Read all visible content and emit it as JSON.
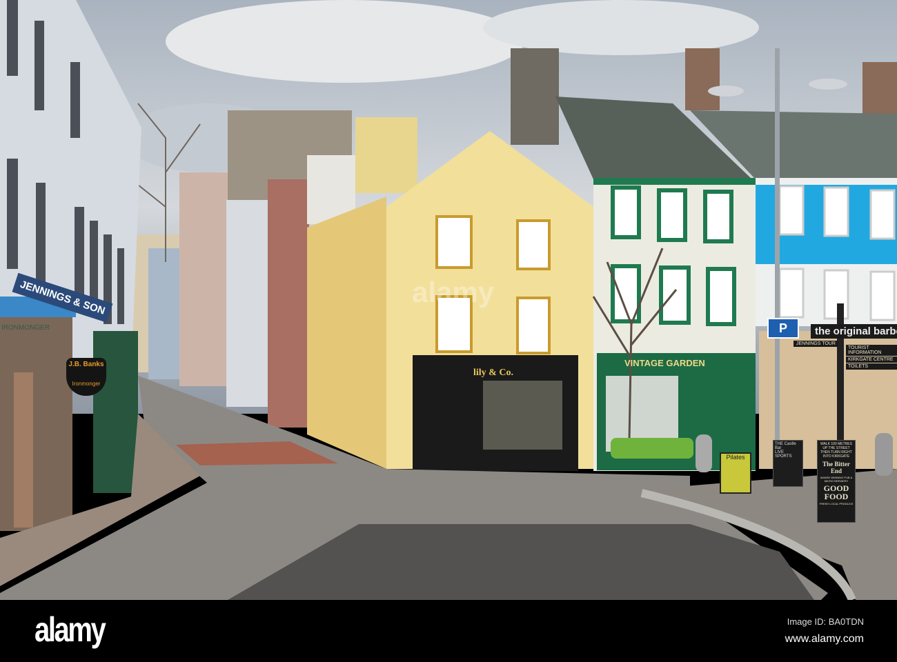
{
  "signs": {
    "shop_yellow": "lily & Co.",
    "shop_green": "VINTAGE GARDEN",
    "barber": "the original barbe",
    "jennings": "JENNINGS TOUR",
    "directions": [
      "TOURIST INFORMATION",
      "KIRKGATE CENTRE",
      "TOILETS"
    ],
    "parking": "P",
    "pilates": "Pilates",
    "left_shop": "JENNINGS & SON",
    "left_shop_sub": "IRONMONGER",
    "banks": "J.B. Banks",
    "banks_sub": "Ironmonger",
    "board_castle": "THE Castle Bar",
    "board_castle_sub": "LIVE SPORTS",
    "board_bitter_top": "WALK 100 METRES UP THE STREET THEN TURN RIGHT INTO KIRKGATE",
    "board_bitter_name": "The Bitter End",
    "board_bitter_mid": "AWARD WINNING PUB & MICRO BREWERY",
    "board_bitter_food": "GOOD FOOD",
    "board_bitter_bottom": "FRESH LOCAL PRODUCE"
  },
  "watermark": {
    "center": "alamy",
    "logo": "alamy",
    "image_id": "Image ID: BA0TDN",
    "site": "www.alamy.com"
  }
}
